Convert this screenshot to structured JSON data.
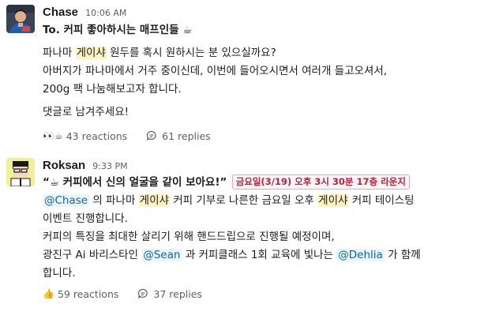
{
  "message1": {
    "author": "Chase",
    "time": "10:06 AM",
    "title": "To. 커피 좋아하시는 매프인들 ☕",
    "line1_a": "파나마 ",
    "line1_hl": "게이샤",
    "line1_b": " 원두를 혹시 원하시는 분 있으실까요?",
    "line2": "아버지가 파나마에서 거주 중이신데, 이번에 들어오시면서 여러개 들고오셔서,",
    "line3": "200g 팩 나눔해보고자 합니다.",
    "line4": "댓글로 남겨주세요!",
    "reactions_emoji": "👀☕",
    "reactions_label": "43 reactions",
    "replies_label": "61 replies"
  },
  "message2": {
    "author": "Roksan",
    "time": "9:33 PM",
    "quote": "“☕ 커피에서 신의 얼굴을 같이 보아요!”",
    "date_badge": "금요일(3/19) 오후 3시 30분 17층 라운지",
    "mention_chase": "@Chase",
    "line2_a": " 의 파나마 ",
    "line2_hl1": "게이샤",
    "line2_b": " 커피 기부로 나른한 금요일 오후 ",
    "line2_hl2": "게이샤",
    "line2_c": " 커피 테이스팅",
    "line3": "이벤트 진행합니다.",
    "line4": "커피의 특징을 최대한 살리기 위해 핸드드립으로 진행될 예정이며,",
    "line5_a": "광진구 Ai 바리스타인 ",
    "mention_sean": "@Sean",
    "line5_b": " 과 커피클래스 1회 교육에 빛나는 ",
    "mention_dehlia": "@Dehlia",
    "line5_c": " 가 함께",
    "line6": "합니다.",
    "reactions_emoji": "👍",
    "reactions_label": "59 reactions",
    "replies_label": "37 replies"
  }
}
